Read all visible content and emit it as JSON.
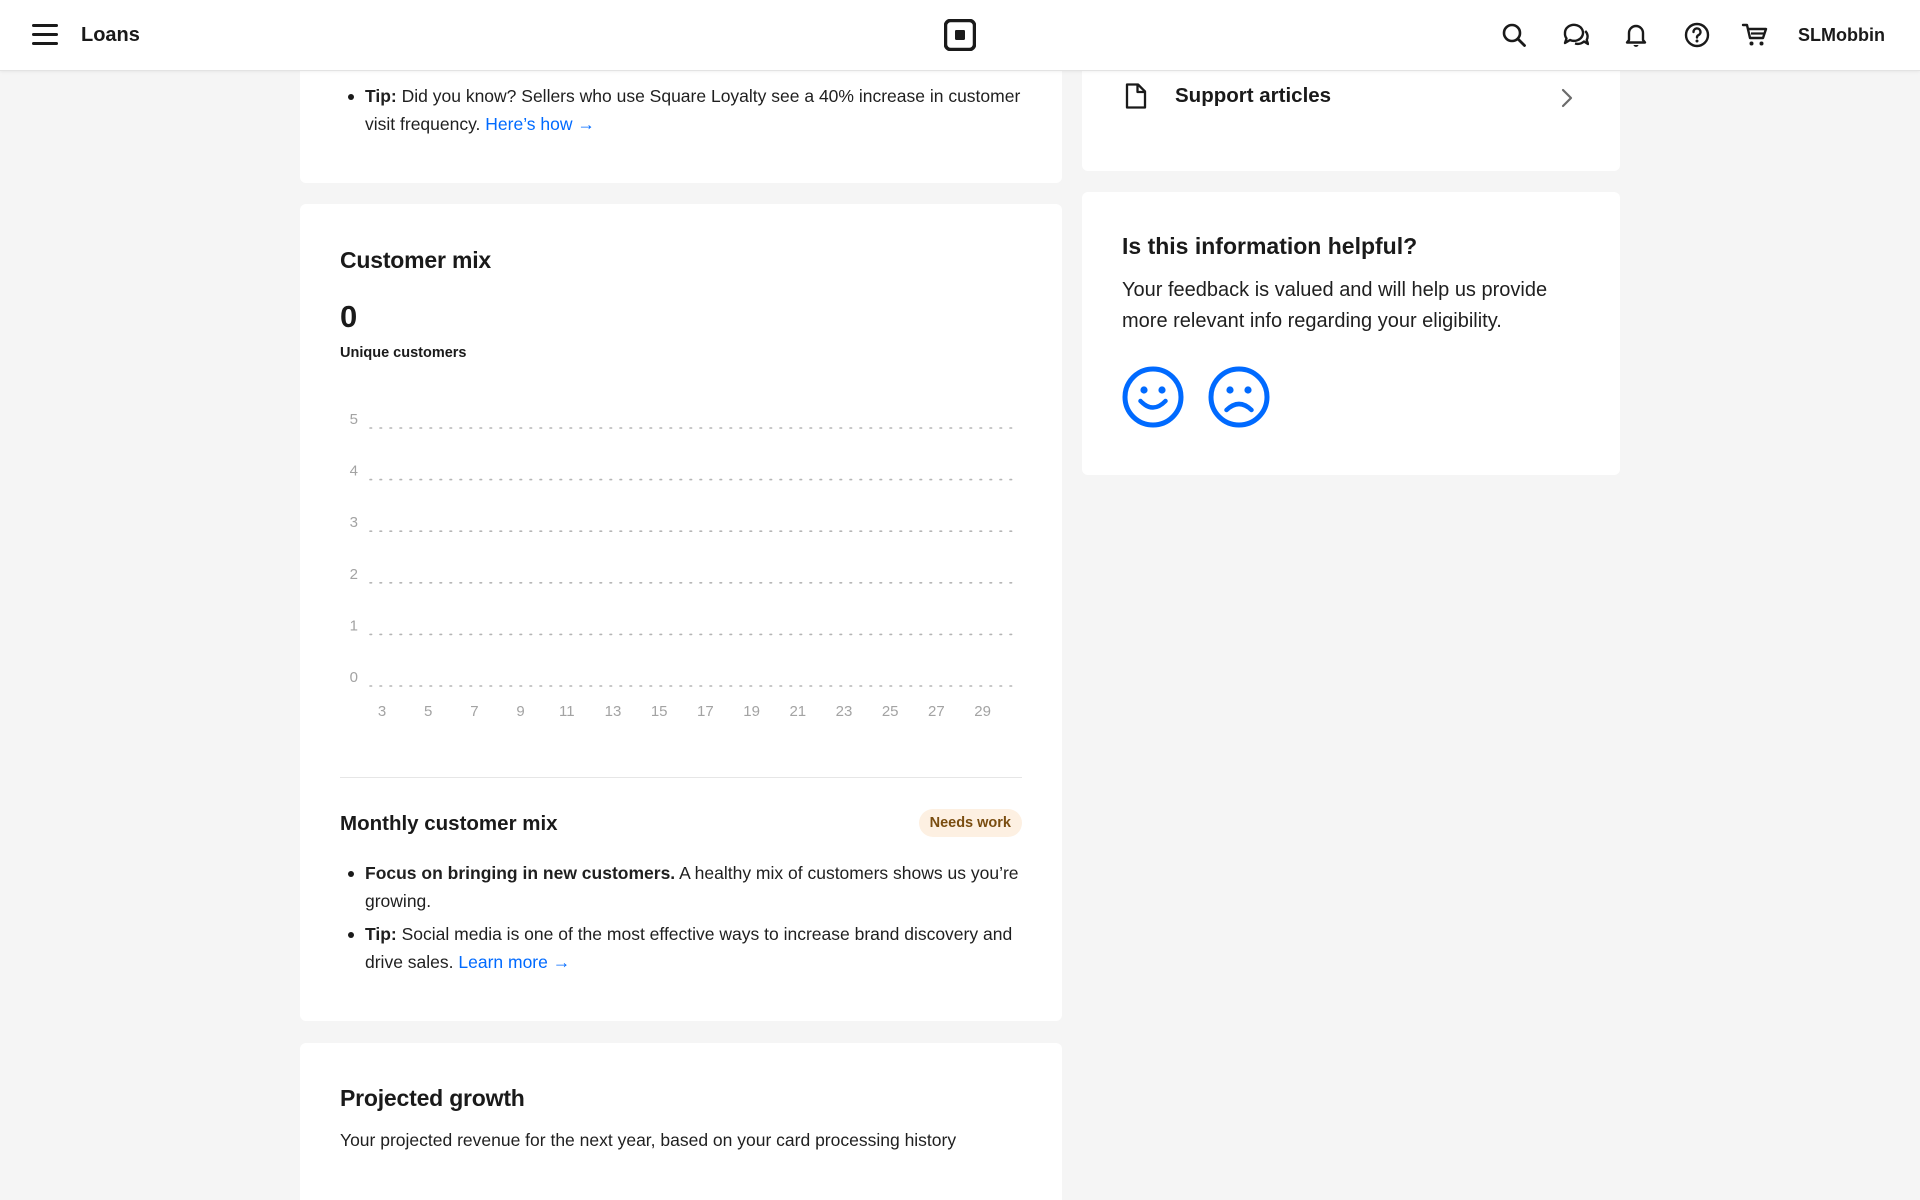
{
  "topbar": {
    "title": "Loans",
    "user": "SLMobbin",
    "icons": [
      "menu-icon",
      "square-logo-icon",
      "search-icon",
      "messages-icon",
      "bell-icon",
      "help-icon",
      "cart-icon"
    ]
  },
  "loyalty": {
    "tip_label": "Tip:",
    "tip_text": " Did you know? Sellers who use Square Loyalty see a 40% increase in customer visit frequency. ",
    "tip_link": "Here’s how →"
  },
  "customer_mix": {
    "title": "Customer mix",
    "value": "0",
    "value_label": "Unique customers",
    "monthly_title": "Monthly customer mix",
    "status_badge": "Needs work",
    "bullet1_bold": "Focus on bringing in new customers.",
    "bullet1_text": " A healthy mix of customers shows us you’re growing.",
    "bullet2_bold": "Tip:",
    "bullet2_text": " Social media is one of the most effective ways to increase brand discovery and drive sales. ",
    "bullet2_link": "Learn more →"
  },
  "chart_data": {
    "type": "bar",
    "categories": [
      "3",
      "5",
      "7",
      "9",
      "11",
      "13",
      "15",
      "17",
      "19",
      "21",
      "23",
      "25",
      "27",
      "29"
    ],
    "values": [
      0,
      0,
      0,
      0,
      0,
      0,
      0,
      0,
      0,
      0,
      0,
      0,
      0,
      0
    ],
    "yticks": [
      0,
      1,
      2,
      3,
      4,
      5
    ],
    "ylim": [
      0,
      5
    ],
    "grid": "dotted-horizontal",
    "grid_color": "#b5b5b5",
    "tick_color": "#a3a3a3"
  },
  "projected_growth": {
    "title": "Projected growth",
    "subtitle": "Your projected revenue for the next year, based on your card processing history"
  },
  "support": {
    "label": "Support articles",
    "icons": [
      "document-icon",
      "chevron-right-icon"
    ]
  },
  "feedback": {
    "title": "Is this information helpful?",
    "text": "Your feedback is valued and will help us provide more relevant info regarding your eligibility.",
    "icons": [
      "happy-face-icon",
      "sad-face-icon"
    ],
    "accent": "#006aff"
  }
}
